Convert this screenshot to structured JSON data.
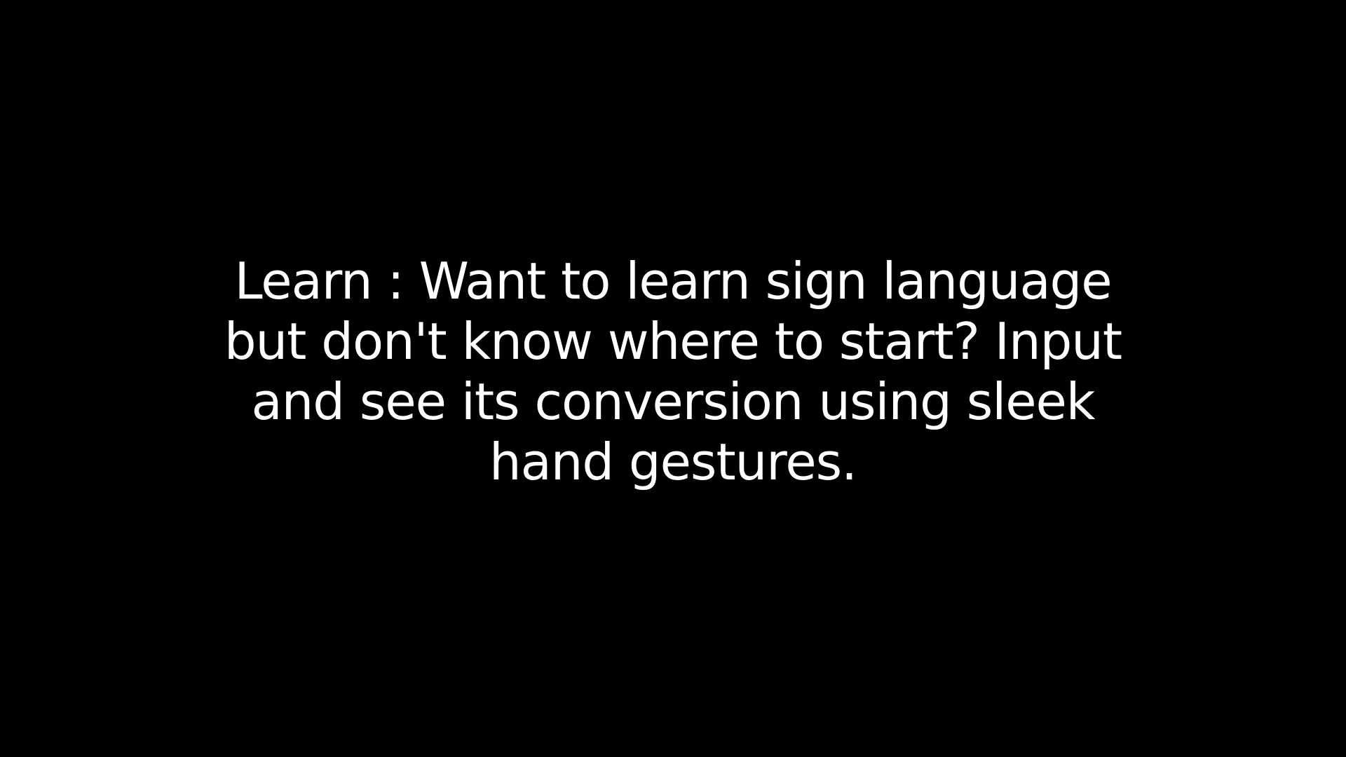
{
  "background_color": "#000000",
  "text_color": "#ffffff",
  "caption": {
    "lines": [
      "Learn : Want to learn sign language",
      "but don't know where to start? Input",
      "and see its conversion using sleek",
      "hand gestures."
    ]
  }
}
